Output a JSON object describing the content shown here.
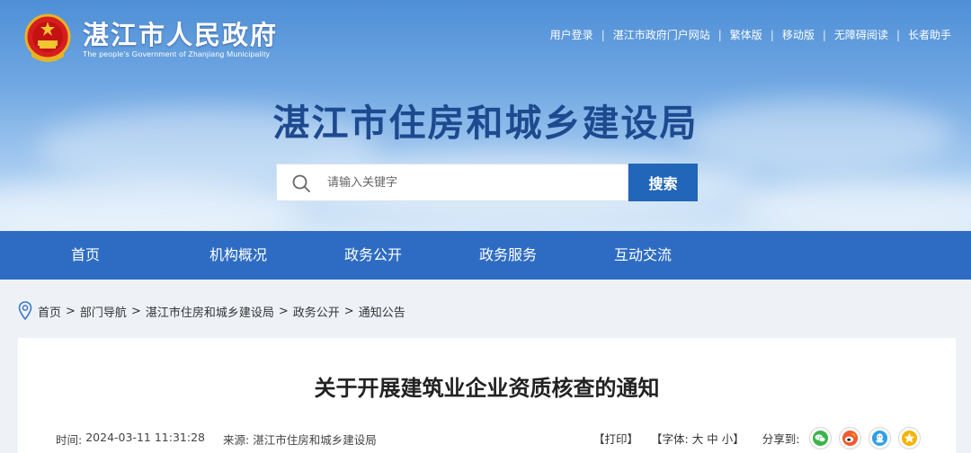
{
  "header": {
    "gov_name": "湛江市人民政府",
    "gov_name_en": "The people's Government of Zhanjiang Municipality",
    "dept_title": "湛江市住房和城乡建设局"
  },
  "top_links": [
    "用户登录",
    "湛江市政府门户网站",
    "繁体版",
    "移动版",
    "无障碍阅读",
    "长者助手"
  ],
  "search": {
    "placeholder": "请输入关键字",
    "button_label": "搜索"
  },
  "nav": [
    "首页",
    "机构概况",
    "政务公开",
    "政务服务",
    "互动交流"
  ],
  "breadcrumb": [
    "首页",
    "部门导航",
    "湛江市住房和城乡建设局",
    "政务公开",
    "通知公告"
  ],
  "breadcrumb_sep": ">",
  "article": {
    "title": "关于开展建筑业企业资质核查的通知",
    "time_label": "时间:",
    "time_value": "2024-03-11 11:31:28",
    "source_label": "来源:",
    "source_value": "湛江市住房和城乡建设局",
    "print_label": "【打印】",
    "font_prefix": "【字体:",
    "font_large": "大",
    "font_medium": "中",
    "font_small": "小",
    "font_suffix": "】",
    "share_label": "分享到:",
    "share_icons": [
      "wechat-icon",
      "weibo-icon",
      "qq-icon",
      "qzone-icon"
    ]
  },
  "colors": {
    "nav_bg": "#2e6cc3",
    "search_button": "#2166b8",
    "dept_title": "#1d4a8f",
    "page_bg": "#eef2f7"
  }
}
